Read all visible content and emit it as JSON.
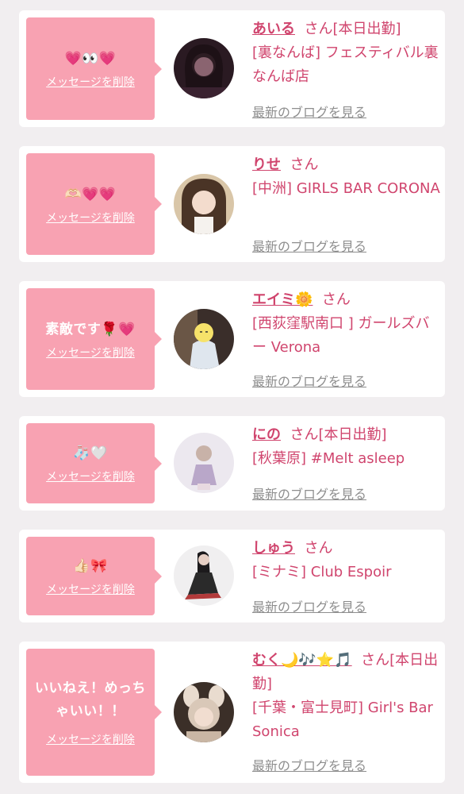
{
  "items": [
    {
      "message": "💗👀💗",
      "delete_label": "メッセージを削除",
      "name": "あいる",
      "suffix": "さん[本日出勤]",
      "shop": "[裏なんば] フェスティバル裏なんば店",
      "blog_label": "最新のブログを見る"
    },
    {
      "message": "🫶🏻💗💗",
      "delete_label": "メッセージを削除",
      "name": "りせ",
      "suffix": "さん",
      "shop": "[中洲] GIRLS BAR CORONA",
      "blog_label": "最新のブログを見る"
    },
    {
      "message": "素敵です🌹💗",
      "delete_label": "メッセージを削除",
      "name": "エイミ🌼",
      "suffix": "さん",
      "shop": "[西荻窪駅南口 ] ガールズバー Verona",
      "blog_label": "最新のブログを見る"
    },
    {
      "message": "🧦🤍",
      "delete_label": "メッセージを削除",
      "name": "にの",
      "suffix": "さん[本日出勤]",
      "shop": "[秋葉原] #Melt asleep",
      "blog_label": "最新のブログを見る"
    },
    {
      "message": "👍🏻🎀",
      "delete_label": "メッセージを削除",
      "name": "しゅう",
      "suffix": "さん",
      "shop": "[ミナミ] Club Espoir",
      "blog_label": "最新のブログを見る"
    },
    {
      "message": "いいねえ！めっちゃいい！！",
      "delete_label": "メッセージを削除",
      "name": "むく🌙🎶⭐️🎵",
      "suffix": "さん[本日出勤]",
      "shop": "[千葉・富士見町] Girl's Bar Sonica",
      "blog_label": "最新のブログを見る"
    }
  ]
}
